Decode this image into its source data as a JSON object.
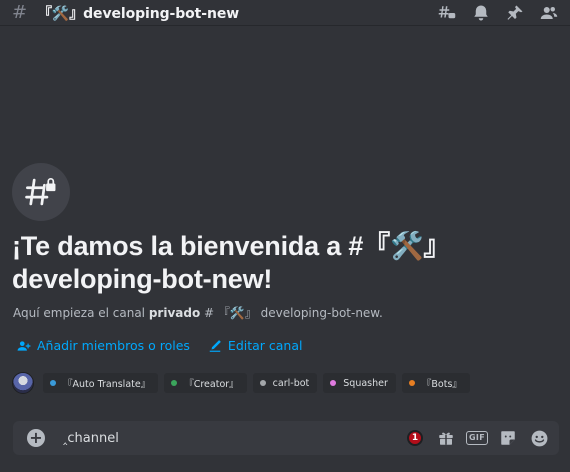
{
  "header": {
    "channel_name": "『🛠️』developing-bot-new",
    "icons": [
      "threads-icon",
      "bell-icon",
      "pin-icon",
      "member-list-icon"
    ]
  },
  "welcome": {
    "title": "¡Te damos la bienvenida a #『🛠️』developing-bot-new!",
    "subtitle_prefix": "Aquí empieza el canal ",
    "subtitle_bold": "privado",
    "subtitle_suffix": " # 『🛠️』 developing-bot-new.",
    "icon": "private-channel-icon"
  },
  "actions": {
    "add_members": "Añadir miembros o roles",
    "edit_channel": "Editar canal"
  },
  "bots": [
    {
      "name": "『Auto Translate』",
      "color": "#3a9ad9"
    },
    {
      "name": "『Creator』",
      "color": "#3ba55c"
    },
    {
      "name": "carl-bot",
      "color": "#a3a6aa"
    },
    {
      "name": "Squasher",
      "color": "#e07be0"
    },
    {
      "name": "『Bots』",
      "color": "#e67e22"
    }
  ],
  "composer": {
    "value": "‸channel",
    "badge_count": "1",
    "gif_label": "GIF"
  },
  "colors": {
    "link": "#00a8fc",
    "background": "#313338"
  }
}
